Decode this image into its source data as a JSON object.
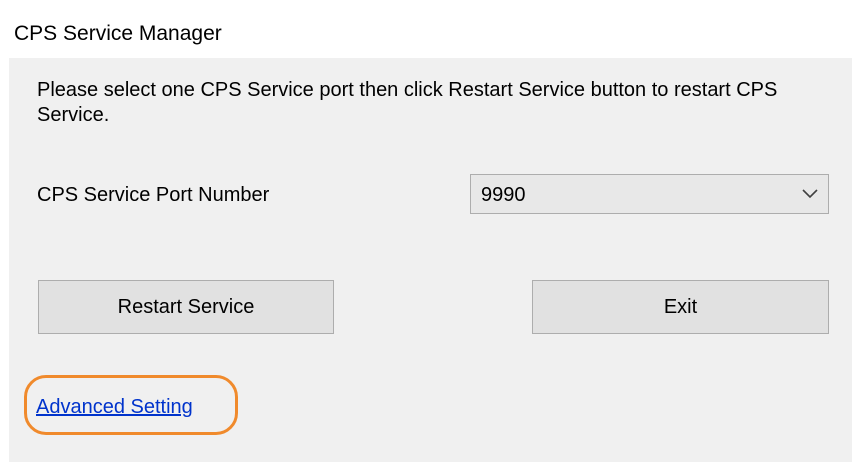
{
  "window": {
    "title": "CPS Service Manager"
  },
  "dialog": {
    "instruction": "Please select one CPS Service port then click Restart Service button to restart CPS Service.",
    "port_label": "CPS Service Port Number",
    "port_select": {
      "selected": "9990"
    },
    "restart_button": "Restart Service",
    "exit_button": "Exit",
    "advanced_link": "Advanced Setting"
  },
  "annotation": {
    "highlight_color": "#f08a2c",
    "highlight_target": "advanced-setting-link"
  },
  "icons": {
    "combo_arrow": "chevron-down-icon"
  }
}
